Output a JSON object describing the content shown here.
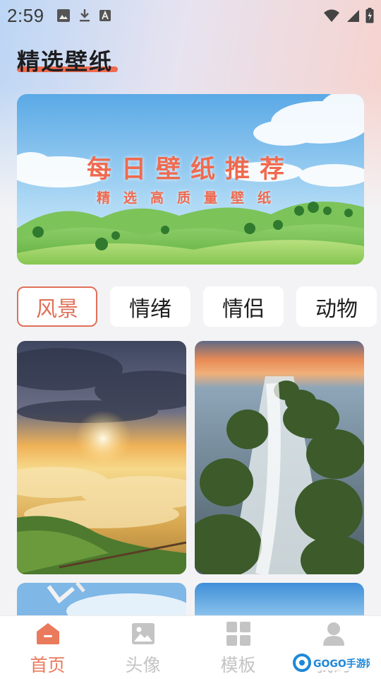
{
  "status_bar": {
    "time": "2:59"
  },
  "page": {
    "title": "精选壁纸"
  },
  "banner": {
    "title": "每日壁纸推荐",
    "subtitle": "精选高质量壁纸"
  },
  "categories": [
    {
      "label": "风景",
      "active": true
    },
    {
      "label": "情绪",
      "active": false
    },
    {
      "label": "情侣",
      "active": false
    },
    {
      "label": "动物",
      "active": false
    }
  ],
  "nav": [
    {
      "label": "首页",
      "icon": "home-icon",
      "active": true
    },
    {
      "label": "头像",
      "icon": "image-icon",
      "active": false
    },
    {
      "label": "模板",
      "icon": "grid-icon",
      "active": false
    },
    {
      "label": "我的",
      "icon": "user-icon",
      "active": false
    }
  ],
  "watermark": {
    "text": "GOGO手游网",
    "site": "GOGO.CN"
  },
  "colors": {
    "accent": "#ef6a4f",
    "nav_active": "#e97a5c",
    "nav_inactive": "#c4c4c4"
  }
}
